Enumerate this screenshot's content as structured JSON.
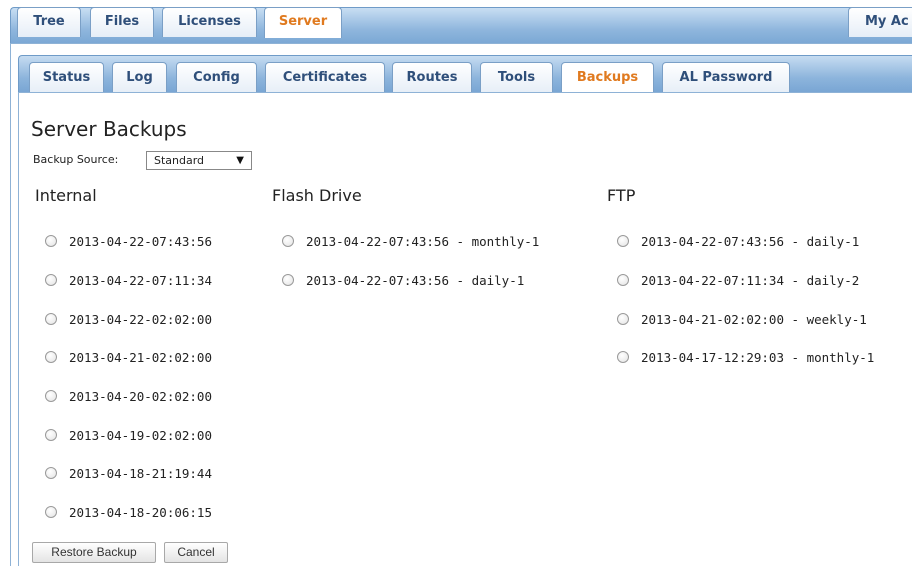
{
  "outer_tabs": [
    {
      "label": "Tree"
    },
    {
      "label": "Files"
    },
    {
      "label": "Licenses"
    },
    {
      "label": "Server"
    },
    {
      "label": "My Ac"
    }
  ],
  "outer_active": "Server",
  "inner_tabs": [
    {
      "label": "Status"
    },
    {
      "label": "Log"
    },
    {
      "label": "Config"
    },
    {
      "label": "Certificates"
    },
    {
      "label": "Routes"
    },
    {
      "label": "Tools"
    },
    {
      "label": "Backups"
    },
    {
      "label": "AL Password"
    }
  ],
  "inner_active": "Backups",
  "page": {
    "title": "Server Backups",
    "source_label": "Backup Source:",
    "source_value": "Standard"
  },
  "columns": {
    "internal": {
      "heading": "Internal",
      "items": [
        "2013-04-22-07:43:56",
        "2013-04-22-07:11:34",
        "2013-04-22-02:02:00",
        "2013-04-21-02:02:00",
        "2013-04-20-02:02:00",
        "2013-04-19-02:02:00",
        "2013-04-18-21:19:44",
        "2013-04-18-20:06:15"
      ]
    },
    "flash": {
      "heading": "Flash Drive",
      "items": [
        "2013-04-22-07:43:56 - monthly-1",
        "2013-04-22-07:43:56 - daily-1"
      ]
    },
    "ftp": {
      "heading": "FTP",
      "items": [
        "2013-04-22-07:43:56 - daily-1",
        "2013-04-22-07:11:34 - daily-2",
        "2013-04-21-02:02:00 - weekly-1",
        "2013-04-17-12:29:03 - monthly-1"
      ]
    }
  },
  "buttons": {
    "restore": "Restore Backup",
    "cancel": "Cancel"
  }
}
